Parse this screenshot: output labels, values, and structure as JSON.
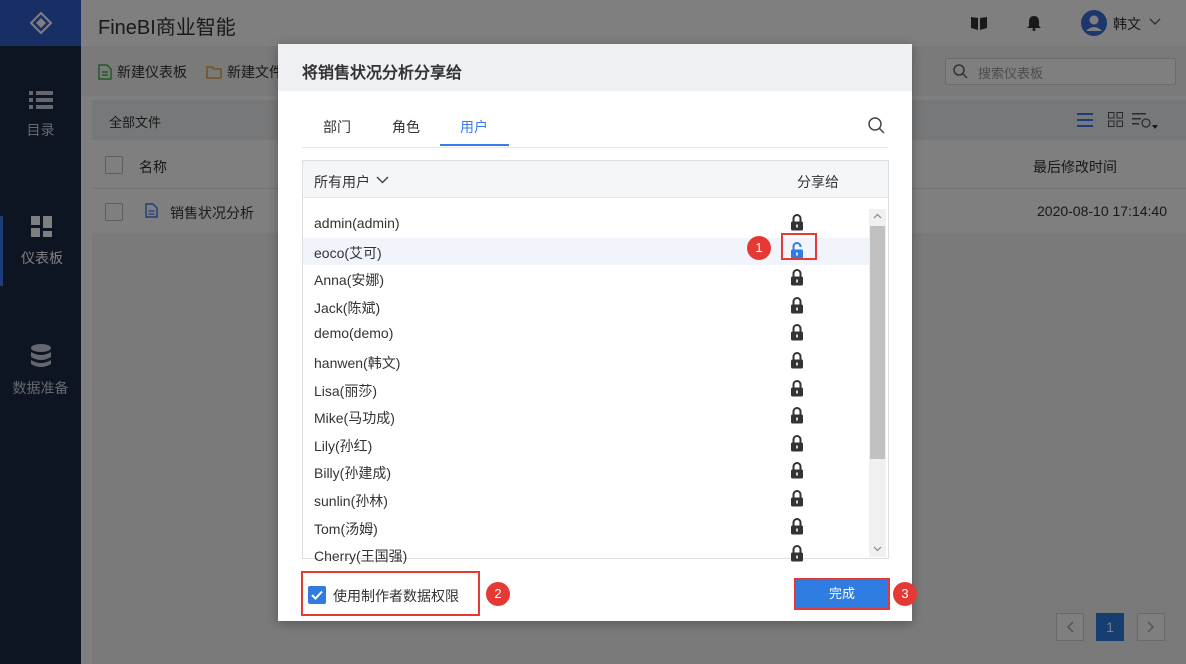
{
  "app": {
    "title": "FineBI商业智能",
    "user_name": "韩文"
  },
  "sidebar": {
    "items": [
      {
        "label": "目录",
        "icon": "list-icon"
      },
      {
        "label": "仪表板",
        "icon": "dashboard-icon"
      },
      {
        "label": "数据准备",
        "icon": "database-icon"
      }
    ]
  },
  "toolbar": {
    "new_dashboard": "新建仪表板",
    "new_folder": "新建文件",
    "search_placeholder": "搜索仪表板"
  },
  "breadcrumb": "全部文件",
  "table": {
    "col_name": "名称",
    "col_modified": "最后修改时间",
    "rows": [
      {
        "name": "销售状况分析",
        "modified": "2020-08-10 17:14:40"
      }
    ]
  },
  "pagination": {
    "current": "1"
  },
  "dialog": {
    "title": "将销售状况分析分享给",
    "tabs": [
      "部门",
      "角色",
      "用户"
    ],
    "active_tab": "用户",
    "list_filter": "所有用户",
    "list_col_share": "分享给",
    "users": [
      {
        "name": "admin(admin)",
        "shared": false
      },
      {
        "name": "eoco(艾可)",
        "shared": true
      },
      {
        "name": "Anna(安娜)",
        "shared": false
      },
      {
        "name": "Jack(陈斌)",
        "shared": false
      },
      {
        "name": "demo(demo)",
        "shared": false
      },
      {
        "name": "hanwen(韩文)",
        "shared": false
      },
      {
        "name": "Lisa(丽莎)",
        "shared": false
      },
      {
        "name": "Mike(马功成)",
        "shared": false
      },
      {
        "name": "Lily(孙红)",
        "shared": false
      },
      {
        "name": "Billy(孙建成)",
        "shared": false
      },
      {
        "name": "sunlin(孙林)",
        "shared": false
      },
      {
        "name": "Tom(汤姆)",
        "shared": false
      },
      {
        "name": "Cherry(王国强)",
        "shared": false
      }
    ],
    "owner_permission_label": "使用制作者数据权限",
    "owner_permission_checked": true,
    "done_label": "完成"
  },
  "annotations": [
    "1",
    "2",
    "3"
  ],
  "colors": {
    "accent": "#2f7de1",
    "annotation": "#e53935",
    "sidebar_bg": "#1c2b44"
  }
}
